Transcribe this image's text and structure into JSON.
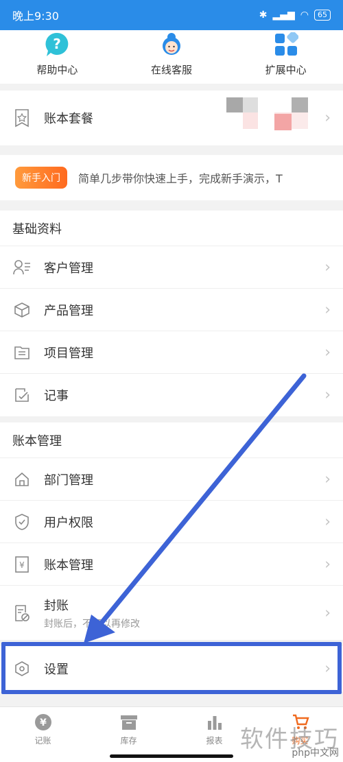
{
  "status": {
    "time": "晚上9:30",
    "battery": "65"
  },
  "quick": [
    {
      "label": "帮助中心",
      "icon": "help-icon"
    },
    {
      "label": "在线客服",
      "icon": "support-agent-icon"
    },
    {
      "label": "扩展中心",
      "icon": "extensions-icon"
    }
  ],
  "package": {
    "label": "账本套餐"
  },
  "newbie": {
    "badge": "新手入门",
    "text": "简单几步带你快速上手，完成新手演示，T"
  },
  "basic": {
    "title": "基础资料",
    "items": [
      {
        "label": "客户管理"
      },
      {
        "label": "产品管理"
      },
      {
        "label": "项目管理"
      },
      {
        "label": "记事"
      }
    ]
  },
  "ledger": {
    "title": "账本管理",
    "items": [
      {
        "label": "部门管理"
      },
      {
        "label": "用户权限"
      },
      {
        "label": "账本管理"
      },
      {
        "label": "封账",
        "sub": "封账后，不可以再修改"
      }
    ]
  },
  "settings": {
    "label": "设置"
  },
  "tabs": [
    {
      "label": "记账"
    },
    {
      "label": "库存"
    },
    {
      "label": "报表"
    },
    {
      "label": "购买"
    }
  ],
  "watermark": "软件技巧",
  "watermark_small": "php中文网",
  "colors": {
    "primary": "#2a8ce8",
    "accent": "#f06a1f",
    "arrow": "#3d63d6"
  }
}
